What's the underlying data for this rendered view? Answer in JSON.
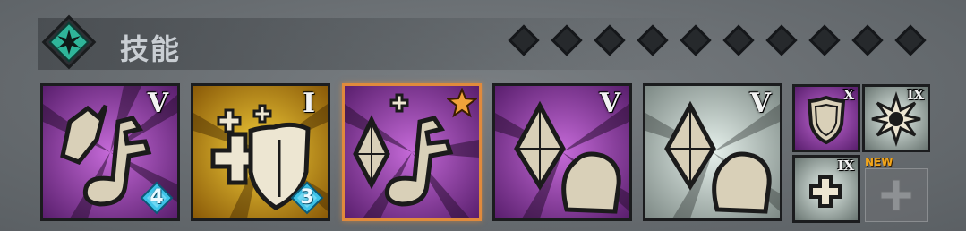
{
  "header": {
    "title": "技能",
    "emblem_icon": "star-emblem-icon",
    "star_slots_count": 10
  },
  "skills": [
    {
      "name": "skill-music-note-feather",
      "icon": "music-note-feather-icon",
      "rank": "V",
      "badge_value": "4",
      "bg": "purple"
    },
    {
      "name": "skill-heal-shield",
      "icon": "heal-shield-icon",
      "rank": "I",
      "badge_value": "3",
      "bg": "gold"
    },
    {
      "name": "skill-crystal-note",
      "icon": "crystal-note-icon",
      "rank": "",
      "badge_icon": "star-icon",
      "bg": "purple",
      "selected": true
    },
    {
      "name": "skill-crystal-flex",
      "icon": "crystal-flex-icon",
      "rank": "V",
      "bg": "purple"
    },
    {
      "name": "skill-crystal-flex-pale",
      "icon": "crystal-flex-icon",
      "rank": "V",
      "bg": "pale"
    }
  ],
  "passives": [
    {
      "name": "passive-shield",
      "icon": "shield-icon",
      "rank": "X",
      "bg": "purple"
    },
    {
      "name": "passive-burst",
      "icon": "burst-icon",
      "rank": "IX",
      "bg": "pale"
    },
    {
      "name": "passive-heal",
      "icon": "plus-icon",
      "rank": "IX",
      "bg": "pale"
    },
    {
      "name": "passive-empty",
      "icon": "cross-icon",
      "new_label": "NEW"
    }
  ]
}
